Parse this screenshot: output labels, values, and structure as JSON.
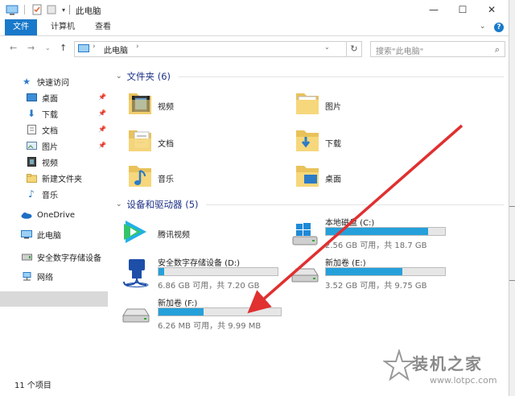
{
  "window": {
    "title": "此电脑",
    "controls": {
      "minimize": "—",
      "maximize": "☐",
      "close": "✕"
    }
  },
  "ribbon": {
    "tabs": [
      {
        "label": "文件",
        "active": true
      },
      {
        "label": "计算机",
        "active": false
      },
      {
        "label": "查看",
        "active": false
      }
    ],
    "accent_color": "#1979ca"
  },
  "address_bar": {
    "path": "此电脑",
    "search_placeholder": "搜索\"此电脑\""
  },
  "navigation": {
    "quick_access": "快速访问",
    "items": [
      {
        "label": "桌面",
        "icon": "desktop-icon",
        "pinned": true
      },
      {
        "label": "下载",
        "icon": "download-icon",
        "pinned": true
      },
      {
        "label": "文档",
        "icon": "document-icon",
        "pinned": true
      },
      {
        "label": "图片",
        "icon": "picture-icon",
        "pinned": true
      },
      {
        "label": "视频",
        "icon": "video-icon",
        "pinned": false
      },
      {
        "label": "新建文件夹",
        "icon": "folder-icon",
        "pinned": false
      },
      {
        "label": "音乐",
        "icon": "music-icon",
        "pinned": false
      }
    ],
    "onedrive": "OneDrive",
    "this_pc": "此电脑",
    "secure_device": "安全数字存储设备",
    "network": "网络"
  },
  "content": {
    "folders_header": "文件夹 (6)",
    "folders": [
      {
        "label": "视频",
        "icon": "video-folder-icon"
      },
      {
        "label": "图片",
        "icon": "picture-folder-icon"
      },
      {
        "label": "文档",
        "icon": "document-folder-icon"
      },
      {
        "label": "下载",
        "icon": "download-folder-icon"
      },
      {
        "label": "音乐",
        "icon": "music-folder-icon"
      },
      {
        "label": "桌面",
        "icon": "desktop-folder-icon"
      }
    ],
    "drives_header": "设备和驱动器 (5)",
    "drives": [
      {
        "name": "腾讯视频",
        "icon": "tencent-video-icon",
        "info": "",
        "used_fraction": null
      },
      {
        "name": "本地磁盘 (C:)",
        "icon": "windows-drive-icon",
        "info": "2.56 GB 可用，共 18.7 GB",
        "used_fraction": 0.86
      },
      {
        "name": "安全数字存储设备 (D:)",
        "icon": "usb-device-icon",
        "info": "6.86 GB 可用，共 7.20 GB",
        "used_fraction": 0.05
      },
      {
        "name": "新加卷 (E:)",
        "icon": "hard-drive-icon",
        "info": "3.52 GB 可用，共 9.75 GB",
        "used_fraction": 0.64
      },
      {
        "name": "新加卷 (F:)",
        "icon": "hard-drive-icon",
        "info": "6.26 MB 可用，共 9.99 MB",
        "used_fraction": 0.37
      }
    ],
    "bar_color": "#26a0da"
  },
  "status_bar": {
    "count": "11 个项目"
  },
  "watermark": {
    "text": "装机之家",
    "url": "www.lotpc.com"
  }
}
